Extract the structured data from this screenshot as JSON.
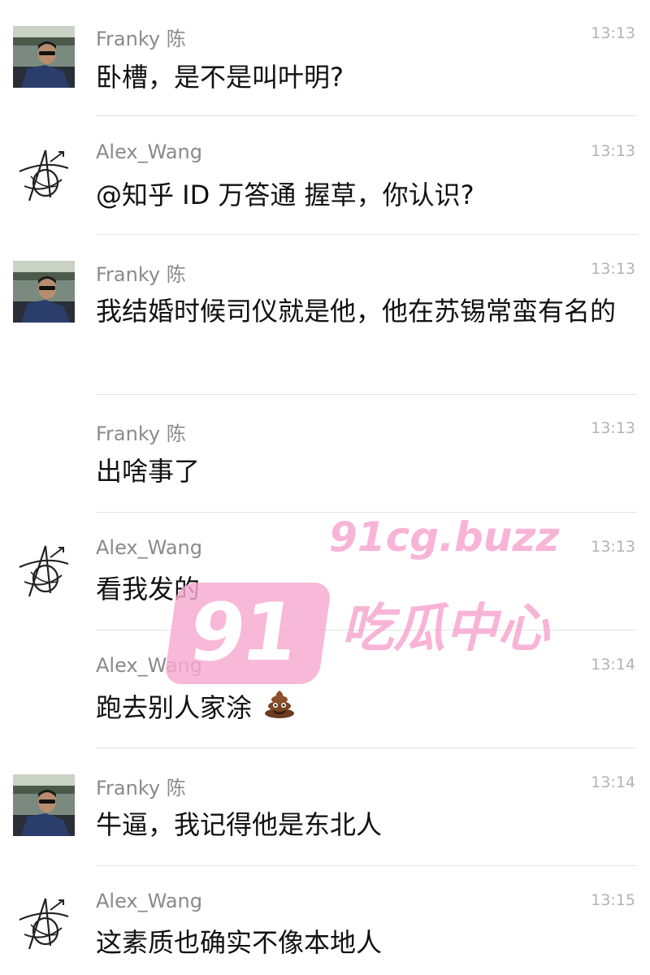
{
  "messages": [
    {
      "sender": "Franky 陈",
      "time": "13:13",
      "text": "卧槽，是不是叫叶明?",
      "avatar": "photo-avatar"
    },
    {
      "sender": "Alex_Wang",
      "time": "13:13",
      "text": "@知乎 ID 万答通 握草，你认识?",
      "avatar": "signature-avatar"
    },
    {
      "sender": "Franky 陈",
      "time": "13:13",
      "text": "我结婚时候司仪就是他，他在苏锡常蛮有名的",
      "avatar": "photo-avatar"
    },
    {
      "sender": "Franky 陈",
      "time": "13:13",
      "text": "出啥事了",
      "avatar": ""
    },
    {
      "sender": "Alex_Wang",
      "time": "13:13",
      "text": "看我发的",
      "avatar": "signature-avatar"
    },
    {
      "sender": "Alex_Wang",
      "time": "13:14",
      "text": "跑去别人家涂",
      "emoji": "poop-emoji",
      "avatar": ""
    },
    {
      "sender": "Franky 陈",
      "time": "13:14",
      "text": "牛逼，我记得他是东北人",
      "avatar": "photo-avatar"
    },
    {
      "sender": "Alex_Wang",
      "time": "13:15",
      "text": "这素质也确实不像本地人",
      "avatar": "signature-avatar"
    }
  ],
  "watermark": {
    "number": "91",
    "url": "91cg.buzz",
    "title": "吃瓜中心",
    "color": "#f7a8d0"
  }
}
